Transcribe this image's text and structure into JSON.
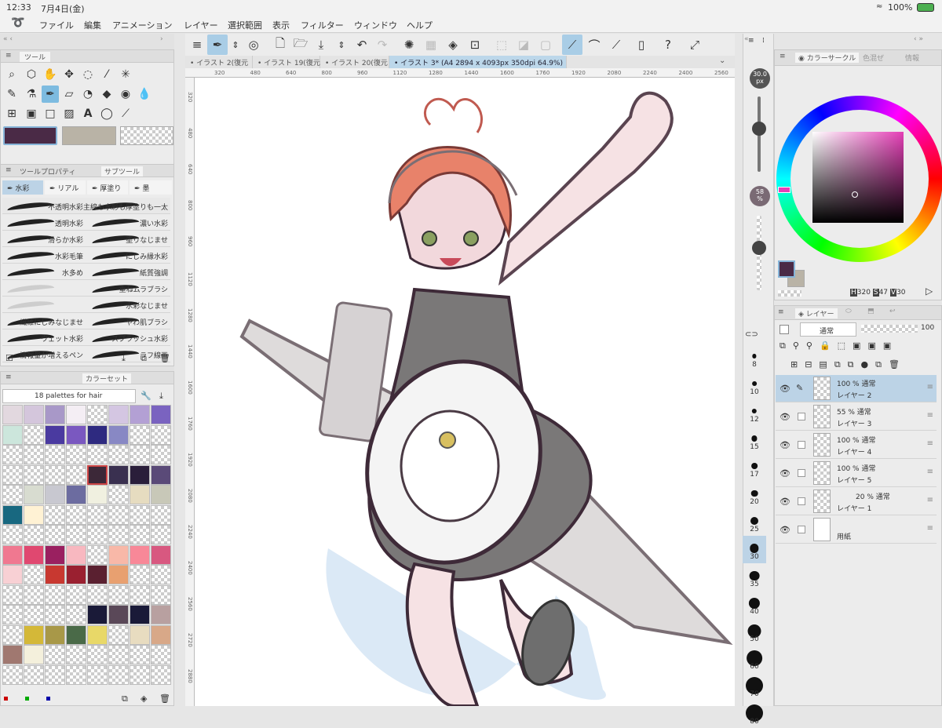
{
  "status": {
    "time": "12:33",
    "date": "7月4日(金)",
    "battery": "100%"
  },
  "menu": [
    "ファイル",
    "編集",
    "アニメーション",
    "レイヤー",
    "選択範囲",
    "表示",
    "フィルター",
    "ウィンドウ",
    "ヘルプ"
  ],
  "tool_panel": {
    "title": "ツール"
  },
  "colors": {
    "main": "#4a2a46",
    "sub": "#b9b3a6",
    "accent": "#7dbbe0",
    "layer_sel": "#bcd3e6"
  },
  "subtool": {
    "tabs": [
      "ツールプロパティ",
      "サブツール"
    ],
    "groups": [
      "水彩",
      "リアル",
      "厚塗り",
      "墨"
    ],
    "brushes": [
      [
        "不透明水彩",
        "主線も水彩も厚塗りも一太"
      ],
      [
        "透明水彩",
        "濃い水彩"
      ],
      [
        "滑らか水彩",
        "塗りなじませ"
      ],
      [
        "水彩毛筆",
        "にじみ縁水彩"
      ],
      [
        "水多め",
        "紙質強調"
      ],
      [
        "",
        "重ねムラブラシ"
      ],
      [
        "",
        "水彩なじませ"
      ],
      [
        "繊維にじみなじませ",
        "やわ肌ブラシ"
      ],
      [
        "ウェット水彩",
        "スプラッシュ水彩"
      ],
      [
        "情報量が増えるペン",
        "ラフ線画"
      ]
    ]
  },
  "colorset": {
    "title": "カラーセット",
    "palette_name": "18 palettes for hair",
    "rows": [
      [
        "#e2d8df",
        "#d4c6dc",
        "#a898c8",
        "#f4eef4",
        "T",
        "#d4c6e2",
        "#b3a0d4",
        "#7a63c0"
      ],
      [
        "#cce6dc",
        "T",
        "#4a3aa0",
        "#7a58c0",
        "#2e2a80",
        "#8888c4",
        "T",
        "T"
      ],
      [
        "T",
        "T",
        "T",
        "T",
        "T",
        "T",
        "T",
        "T"
      ],
      [
        "T",
        "T",
        "T",
        "T",
        "#3c2838",
        "#3a3050",
        "#2a1e3a",
        "#5a4a78"
      ],
      [
        "T",
        "#d8dcd0",
        "#c8c8d0",
        "#6c6ca0",
        "#f0f0e0",
        "T",
        "#e6dcc0",
        "#c8c8b8"
      ],
      [
        "#186880",
        "#fff2d4",
        "T",
        "T",
        "T",
        "T",
        "T",
        "T"
      ],
      [
        "T",
        "T",
        "T",
        "T",
        "T",
        "T",
        "T",
        "T"
      ],
      [
        "#f07890",
        "#e04870",
        "#9a2060",
        "#f8b8c0",
        "T",
        "#f8b8a8",
        "#f88898",
        "#d85880"
      ],
      [
        "#f8d0d4",
        "T",
        "#c83830",
        "#9a2030",
        "#5a2030",
        "#e8a070",
        "T",
        "T"
      ],
      [
        "T",
        "T",
        "T",
        "T",
        "T",
        "T",
        "T",
        "T"
      ],
      [
        "T",
        "T",
        "T",
        "T",
        "#1a1a38",
        "#5a4858",
        "#1a1a38",
        "#b8a0a0"
      ],
      [
        "T",
        "#d4b838",
        "#a89848",
        "#4a6a48",
        "#e8d868",
        "T",
        "#e8dcc0",
        "#d8a888"
      ],
      [
        "#a07870",
        "#f4f0dc",
        "T",
        "T",
        "T",
        "T",
        "T",
        "T"
      ],
      [
        "T",
        "T",
        "T",
        "T",
        "T",
        "T",
        "T",
        "T"
      ]
    ]
  },
  "tabs": [
    "イラスト 2(復元",
    "イラスト 19(復元",
    "イラスト 20(復元",
    "イラスト 3* (A4 2894 x 4093px 350dpi 64.9%)"
  ],
  "ruler_h": [
    "320",
    "480",
    "640",
    "800",
    "960",
    "1120",
    "1280",
    "1440",
    "1600",
    "1760",
    "1920",
    "2080",
    "2240",
    "2400",
    "2560"
  ],
  "ruler_v": [
    "320",
    "480",
    "640",
    "800",
    "960",
    "1120",
    "1280",
    "1440",
    "1600",
    "1760",
    "1920",
    "2080",
    "2240",
    "2400",
    "2560",
    "2720",
    "2880"
  ],
  "brush_size": {
    "value": "30.0",
    "unit": "px",
    "opacity": "58",
    "opacity_unit": "%",
    "sizes": [
      "8",
      "10",
      "12",
      "15",
      "17",
      "20",
      "25",
      "30",
      "35",
      "40",
      "50",
      "60",
      "70",
      "80"
    ]
  },
  "colorwheel": {
    "title": "カラーサークル",
    "tab2": "色混ぜ",
    "tab3": "情報",
    "h_label": "H",
    "h": "320",
    "s_label": "S",
    "s": "47",
    "v_label": "V",
    "v": "30"
  },
  "layers": {
    "title": "レイヤー",
    "blend": "通常",
    "opacity": "100",
    "items": [
      {
        "pct": "100 %  通常",
        "name": "レイヤー 2"
      },
      {
        "pct": "55 %  通常",
        "name": "レイヤー 3"
      },
      {
        "pct": "100 %  通常",
        "name": "レイヤー 4"
      },
      {
        "pct": "100 %  通常",
        "name": "レイヤー 5"
      },
      {
        "pct": "20 %  通常",
        "name": "レイヤー 1"
      },
      {
        "pct": "",
        "name": "用紙"
      }
    ]
  },
  "icons": [
    "pencil-icon",
    "eraser-icon",
    "hand-icon",
    "move-icon",
    "lasso-icon",
    "eyedropper-icon",
    "wand-icon",
    "fill-icon",
    "text-icon",
    "undo-icon",
    "redo-icon",
    "eye-icon",
    "trash-icon"
  ]
}
